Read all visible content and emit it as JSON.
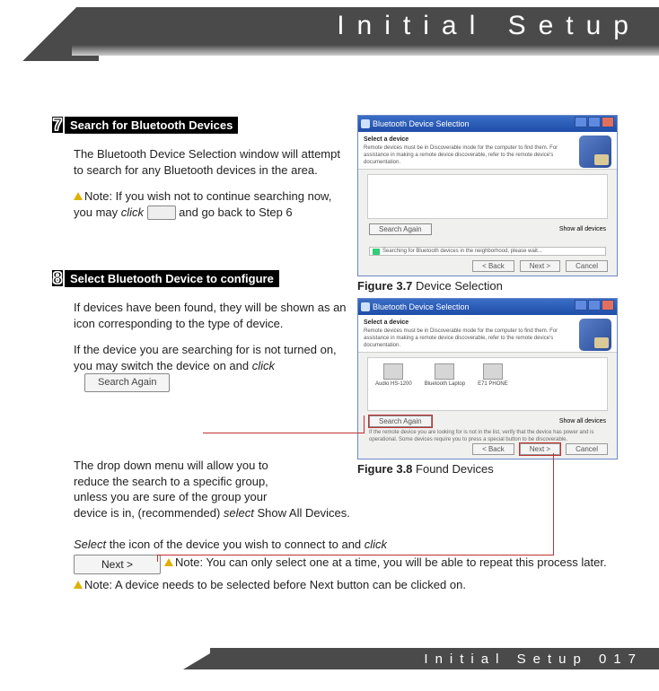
{
  "header": {
    "title": "Initial Setup"
  },
  "footer": {
    "text": "Initial Setup 017"
  },
  "steps": [
    {
      "num": "7",
      "title": "Search for Bluetooth Devices",
      "para1": "The Bluetooth Device Selection window will attempt to search for any Bluetooth devices in the area.",
      "note1_pre": "Note: If you wish not to continue searching now, you may ",
      "note1_click": "click",
      "note1_post": " and go back to Step 6"
    },
    {
      "num": "8",
      "title": "Select Bluetooth Device to configure",
      "para1": "If devices have been found, they will be shown as an icon corresponding to the type of device.",
      "para2a": "If the device you are searching for is not turned on, you may switch the device on and ",
      "para2b": "click",
      "btn_search_again": "Search Again",
      "para3a": "The drop down menu will allow you to reduce the search to a specific group, unless you are sure of the group your device is in, (recommended) ",
      "para3b": "select",
      "para3c": " Show All Devices.",
      "para4a": "Select",
      "para4b": " the icon of the device you wish to connect to and ",
      "para4c": "click",
      "btn_next": "Next >",
      "note2": "Note: You can only select one at a time, you will be able to repeat this process later.",
      "note3": "Note: A device needs to be selected before Next button can be clicked on."
    }
  ],
  "figures": {
    "f37": {
      "label": "Figure 3.7",
      "caption": " Device Selection"
    },
    "f38": {
      "label": "Figure 3.8",
      "caption": " Found Devices"
    }
  },
  "mock": {
    "title": "Bluetooth Device Selection",
    "banner_head": "Select a device",
    "banner_body": "Remote devices must be in Discoverable mode for the computer to find them. For assistance in making a remote device discoverable, refer to the remote device's documentation.",
    "show_all": "Show all devices",
    "search_btn": "Search Again",
    "progress": "Searching for Bluetooth devices in the neighborhood, please wait...",
    "hint2": "If the remote device you are looking for is not in the list, verify that the device has power and is operational. Some devices require you to press a special button to be discoverable.",
    "back": "< Back",
    "next": "Next >",
    "cancel": "Cancel",
    "dev1": "Audio HS-1200",
    "dev2": "Bluetooth Laptop",
    "dev3": "E71 PHONE"
  }
}
